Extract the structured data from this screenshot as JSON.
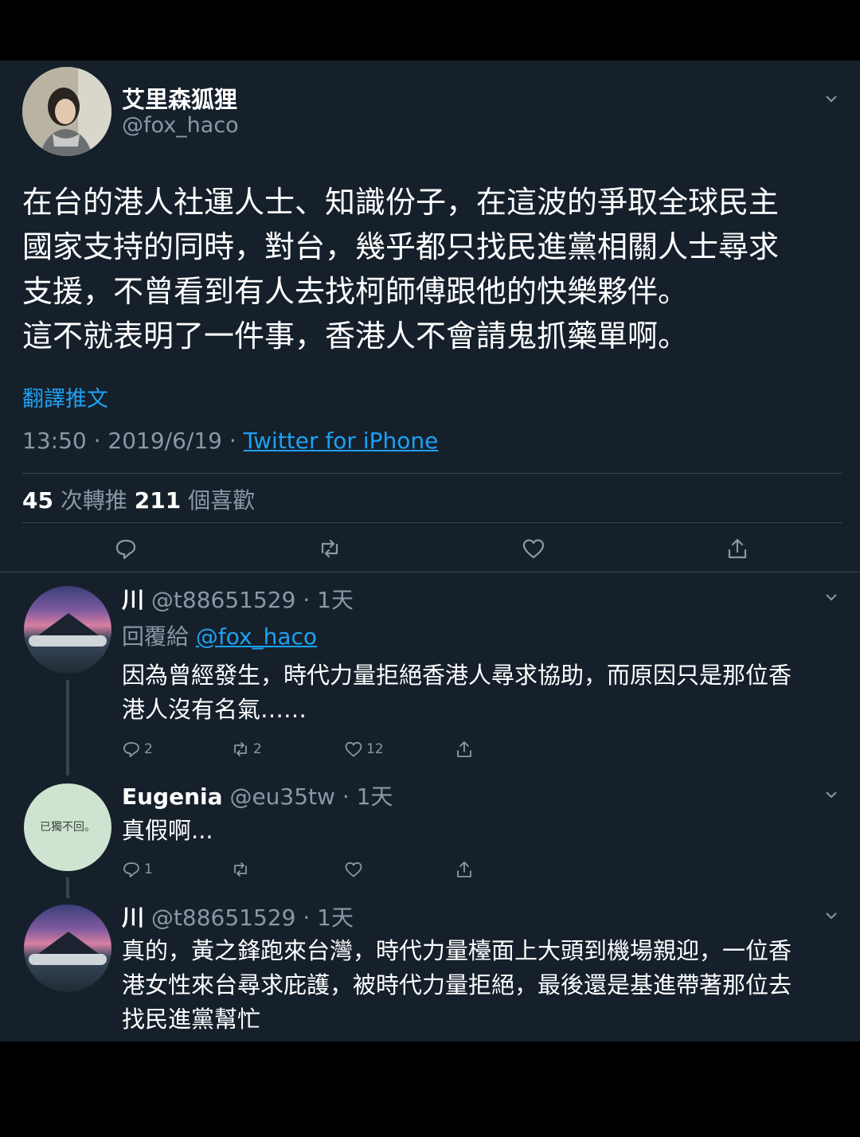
{
  "main": {
    "name": "艾里森狐狸",
    "handle": "@fox_haco",
    "text": "在台的港人社運人士、知識份子，在這波的爭取全球民主\n國家支持的同時，對台，幾乎都只找民進黨相關人士尋求\n支援，不曾看到有人去找柯師傅跟他的快樂夥伴。\n這不就表明了一件事，香港人不會請鬼抓藥單啊。",
    "translate_label": "翻譯推文",
    "time": "13:50 · 2019/6/19 · ",
    "source": "Twitter for iPhone",
    "retweets_count": "45",
    "retweets_label": " 次轉推 ",
    "likes_count": "211",
    "likes_label": " 個喜歡"
  },
  "replies": [
    {
      "name": "川",
      "handle": "@t88651529",
      "time": " · 1天",
      "reply_prefix": "回覆給 ",
      "reply_to": "@fox_haco",
      "text": "因為曾經發生，時代力量拒絕香港人尋求協助，而原因只是那位香\n港人沒有名氣……",
      "reply_count": "2",
      "retweet_count": "2",
      "like_count": "12"
    },
    {
      "name": "Eugenia",
      "handle": "@eu35tw",
      "time": " · 1天",
      "avatar_text": "已獨不回。",
      "text": "真假啊...",
      "reply_count": "1",
      "retweet_count": "",
      "like_count": ""
    },
    {
      "name": "川",
      "handle": "@t88651529",
      "time": " · 1天",
      "text": "真的，黃之鋒跑來台灣，時代力量檯面上大頭到機場親迎，一位香\n港女性來台尋求庇護，被時代力量拒絕，最後還是基進帶著那位去\n找民進黨幫忙"
    }
  ],
  "icons": {
    "reply": "reply-icon",
    "retweet": "retweet-icon",
    "like": "heart-icon",
    "share": "share-icon",
    "more": "chevron-down-icon"
  },
  "colors": {
    "background": "#15202b",
    "link": "#1da1f2",
    "secondary_text": "#8899a6",
    "divider": "#38444d"
  }
}
